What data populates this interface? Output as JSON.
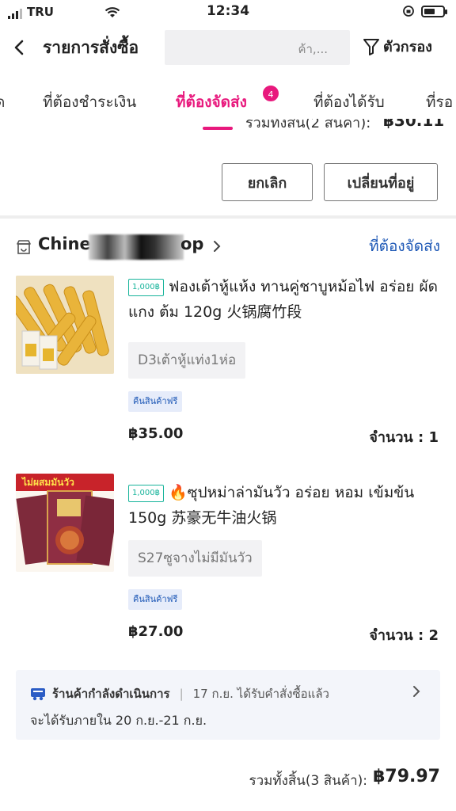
{
  "status_bar": {
    "carrier": "TRU",
    "time": "12:34"
  },
  "header": {
    "back_icon": "chevron-left-icon",
    "title": "รายการสั่งซื้อ",
    "search_placeholder": "ค้า,...",
    "filter_label": "ตัวกรอง"
  },
  "tabs": {
    "items": [
      {
        "label": "ด"
      },
      {
        "label": "ที่ต้องชำระเงิน"
      },
      {
        "label": "ที่ต้องจัดส่ง",
        "active": true,
        "badge": "4"
      },
      {
        "label": "ที่ต้องได้รับ"
      },
      {
        "label": "ที่รอ"
      }
    ]
  },
  "prev_order": {
    "total_label": "รวมทั้งสิ้น(2 สินค้า):",
    "total_value": "฿30.11",
    "cancel_label": "ยกเลิก",
    "change_address_label": "เปลี่ยนที่อยู่"
  },
  "order": {
    "store_name_start": "Chines",
    "store_name_end": "op",
    "status": "ที่ต้องจัดส่ง",
    "items": [
      {
        "ship_tag": "1,000฿",
        "title": "ฟองเต้าหู้แห้ง ทานคู่ชาบูหม้อไฟ อร่อย ผัดแกง ต้ม 120g 火锅腐竹段",
        "variant": "D3เต้าหู้แท่ง1ห่อ",
        "free_return": "คืนสินค้าฟรี",
        "price": "฿35.00",
        "qty": "จำนวน : 1"
      },
      {
        "ship_tag": "1,000฿",
        "title": "🔥ซุปหม่าล่ามันวัว อร่อย หอม เข้มข้น 150g 苏豪无牛油火锅",
        "variant": "S27ซูจางไม่มีมันวัว",
        "free_return": "คืนสินค้าฟรี",
        "price": "฿27.00",
        "qty": "จำนวน : 2",
        "image_banner": "ไม่ผสมมันวัว"
      }
    ],
    "shipping": {
      "title": "ร้านค้ากำลังดำเนินการ",
      "note": "17 ก.ย. ได้รับคำสั่งซื้อแล้ว",
      "eta": "จะได้รับภายใน 20 ก.ย.-21 ก.ย."
    },
    "total_label": "รวมทั้งสิ้น(3 สินค้า):",
    "total_value": "฿79.97"
  },
  "colors": {
    "accent": "#e8197d",
    "link": "#1b56b5",
    "ship_tag": "#18b49b"
  }
}
